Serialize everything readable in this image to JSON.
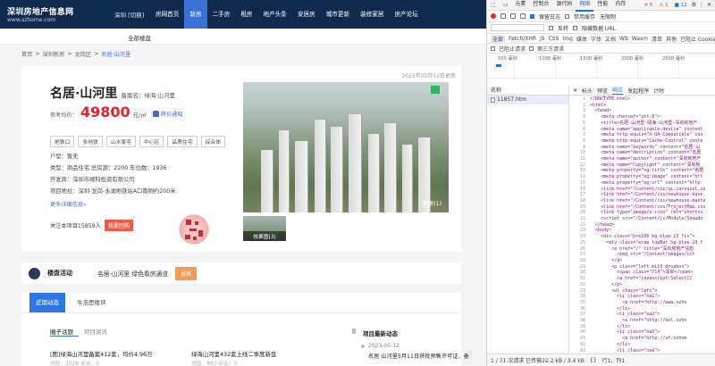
{
  "site": {
    "logo_title": "深圳房地产信息网",
    "logo_sub": "www.szhome.com",
    "city": "深圳 [切换]",
    "nav": [
      "房网首页",
      "新房",
      "二手房",
      "租房",
      "地产头条",
      "安居房",
      "城市更新",
      "装修家居",
      "房产论坛"
    ],
    "nav_active_index": 1,
    "subnav": "全部楼盘",
    "breadcrumb": [
      "首页",
      "深圳新房",
      "龙岗区",
      "名居·山河里"
    ],
    "updated": "2023年05月12日更新",
    "project_name": "名居·山河里",
    "alias": "备案名：绿海·山河里",
    "price_label": "参考均价：",
    "price": "49800",
    "price_unit": "元/㎡",
    "notify": "降价通知",
    "tags": [
      "地铁口",
      "多地铁",
      "山水豪宅",
      "中心区",
      "品质住宅",
      "综合体"
    ],
    "info": [
      "户型：暂无",
      "类型：商品住宅   总房源：2200   车位数：1936",
      "开发商：深圳市顺科投资有限公司",
      "项目地址：深圳-龙岗-永湖地铁站A口南侧约200米"
    ],
    "more": "更多详细信息»",
    "follow": "关注本项目15859人",
    "follow_btn": "我要团购",
    "photo_label": "相册(1)",
    "thumb_label": "效果图(3)",
    "activity_title": "楼盘活动",
    "activity_name": "名居·山河里 绿色看房通道",
    "activity_btn": "报名",
    "tab_active": "近期动态",
    "tab_other": "牛浩思楼评",
    "subtabs": [
      "圈子话题",
      "项目资讯"
    ],
    "news": [
      "[图]绿海山河里备案412套，均价4.96万",
      "绿海山河里432套上线二季度新盘"
    ],
    "news_meta": [
      "浏览：1028   评论：0",
      "浏览：863   评论：0"
    ],
    "latest_title": "项目最新动态",
    "latest_date": "2023-05-12",
    "latest_text": "名居·山河里5月11日获批预售许可证，备"
  },
  "devtools": {
    "tabs": [
      "元素",
      "控制台",
      "源代码",
      "网络",
      "性能",
      "内存"
    ],
    "active_tab": "网络",
    "badges": [
      "✕ 5",
      "⚠ 1",
      "■ 12"
    ],
    "toolbar": [
      "保留日志",
      "禁用缓存",
      "无限制"
    ],
    "row2": [
      "反转",
      "隐藏数据 URL"
    ],
    "filters": [
      "全部",
      "Fetch/XHR",
      "JS",
      "CSS",
      "Img",
      "媒体",
      "字体",
      "文档",
      "WS",
      "Wasm",
      "清单",
      "其他",
      "已阻止 Cookie"
    ],
    "filter_active": "全部",
    "row4": [
      "已阻止请求",
      "第三方请求"
    ],
    "ticks": [
      "500 毫秒",
      "1000 毫秒",
      "1500 毫秒",
      "2000 毫秒",
      "2500 毫秒"
    ],
    "name_header": "名称",
    "file": "11857.htm",
    "panel_tabs": [
      "标头",
      "预览",
      "响应",
      "发起程序",
      "计时"
    ],
    "panel_active": "响应",
    "code": [
      "<!DOCTYPE html>",
      "<html>",
      "  <head>",
      "    <meta charset=\"utf-8\">",
      "    <title>名居·山河里-绿海·山河里-深圳房地产",
      "    <meta name=\"applicable-device\" content",
      "    <meta http-equiv=\"X-UA-Compatible\" con",
      "    <meta http-equiv=\"Cache-Control\" conte",
      "    <meta name=\"keywords\" content=\"名居·山",
      "    <meta name=\"description\" content=\"名居",
      "    <meta name=\"author\" content=\"深圳房地产",
      "    <meta name=\"Copyright\" content=\"深圳房",
      "    <meta property=\"og:title\" content=\"名居",
      "    <meta property=\"og:image\" content=\"htt",
      "    <meta property=\"og:url\" content=\"http:",
      "    <link href=\"/Content/css/ui.carousel.cs",
      "    <link href=\"/Content/css/newhouse-base.",
      "    <link href=\"/Content/css/newhouse-maste",
      "    <link href=\"/Content/css/ProjectMap.css",
      "    <link type=\"image/x-icon\" rel=\"shortcu",
      "    <script src=\"/Content/js/Module/Showdo",
      "  </head>",
      "  <body>",
      "    <div class=\"pre100 bg-blue-23 fix\">",
      "      <div class=\"wrap topBar bg-blue-23 f",
      "        <a href=\"/\" title=\"深圳房地产信息",
      "          <img src=\"/Content/images/sit",
      "        </a>",
      "        <p class=\"left mil0 dropbox\">",
      "          <span class=\"f14\">深圳</span>",
      "          <a href=\"javascript:SelectCi",
      "        </p>",
      "        <ul class=\"left\">",
      "          <li class=\"na1\">",
      "            <a href=\"http://www.szho",
      "          </li>",
      "          <li class=\"na2\">",
      "            <a href=\"http://bol.szho",
      "          </li>",
      "          <li class=\"na3\">",
      "            <a href=\"http://zf.szhom",
      "          </li>",
      "          <li class=\"na4\">",
      "            <a href=\"http://zf.szhom"
    ],
    "status_left": "1 / 71 次请求  已传输22.2 kB / 3.4 kB",
    "status_right": "行1，列1"
  }
}
